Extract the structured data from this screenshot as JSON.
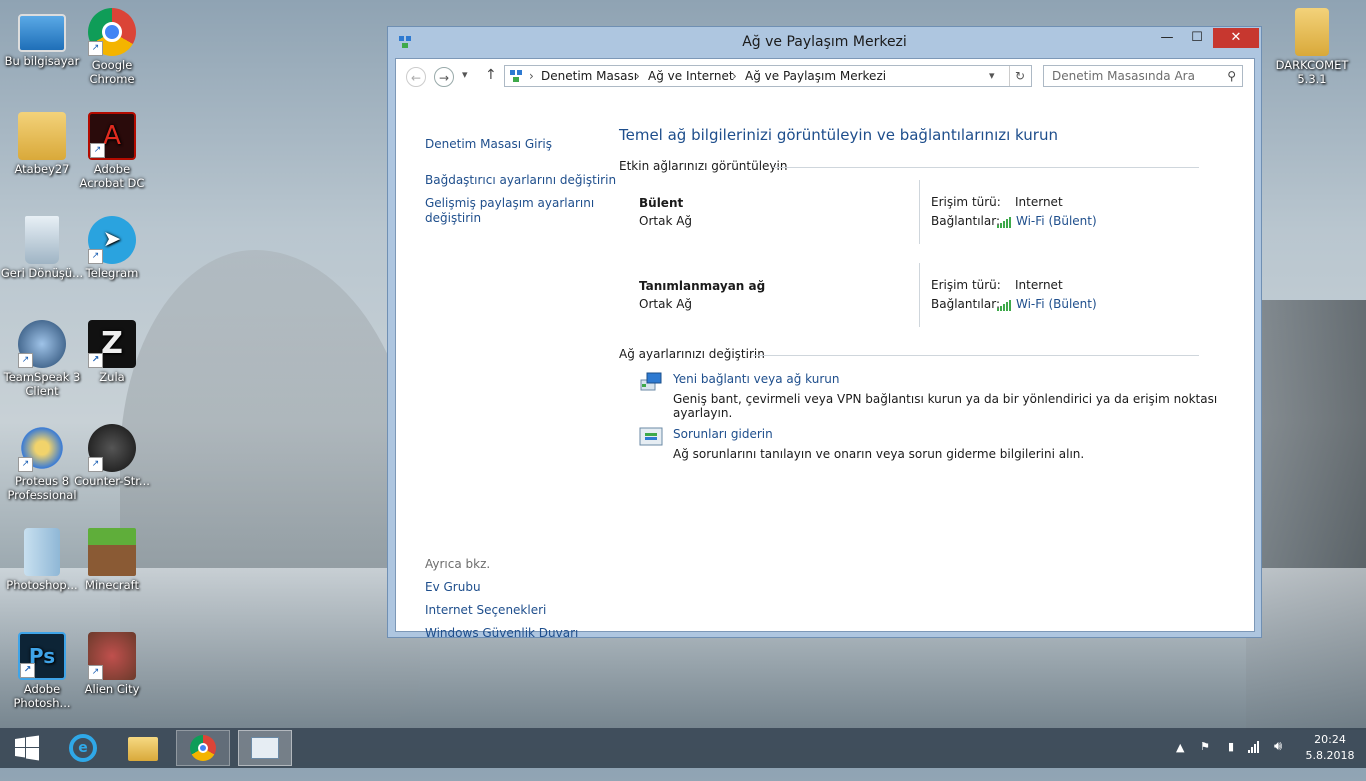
{
  "desktop": {
    "icons": [
      {
        "label": "Bu bilgisayar"
      },
      {
        "label": "Google Chrome"
      },
      {
        "label": "Atabey27"
      },
      {
        "label": "Adobe Acrobat DC"
      },
      {
        "label": "Geri Dönüşü..."
      },
      {
        "label": "Telegram"
      },
      {
        "label": "TeamSpeak 3 Client"
      },
      {
        "label": "Zula"
      },
      {
        "label": "Proteus 8 Professional"
      },
      {
        "label": "Counter-Str..."
      },
      {
        "label": "Photoshop..."
      },
      {
        "label": "Minecraft"
      },
      {
        "label": "Adobe Photosh..."
      },
      {
        "label": "Alien City"
      },
      {
        "label": "DARKCOMET 5.3.1"
      }
    ]
  },
  "window": {
    "title": "Ağ ve Paylaşım Merkezi",
    "controls": {
      "minimize": "—",
      "maximize": "☐",
      "close": "✕"
    },
    "nav": {
      "back": "←",
      "forward": "→",
      "dropdown": "▾",
      "up": "↑",
      "refresh": "↻"
    },
    "breadcrumb": [
      "Denetim Masası",
      "Ağ ve Internet",
      "Ağ ve Paylaşım Merkezi"
    ],
    "breadcrumb_sep": "›",
    "search_placeholder": "Denetim Masasında Ara",
    "sidebar": {
      "home": "Denetim Masası Giriş",
      "links": [
        "Bağdaştırıcı ayarlarını değiştirin",
        "Gelişmiş paylaşım ayarlarını değiştirin"
      ],
      "see_also_title": "Ayrıca bkz.",
      "see_also": [
        "Ev Grubu",
        "Internet Seçenekleri",
        "Windows Güvenlik Duvarı"
      ]
    },
    "main": {
      "title": "Temel ağ bilgilerinizi görüntüleyin ve bağlantılarınızı kurun",
      "active_networks_title": "Etkin ağlarınızı görüntüleyin",
      "access_label": "Erişim türü:",
      "connections_label": "Bağlantılar:",
      "networks": [
        {
          "name": "Bülent",
          "type": "Ortak Ağ",
          "access": "Internet",
          "connection": "Wi-Fi (Bülent)"
        },
        {
          "name": "Tanımlanmayan ağ",
          "type": "Ortak Ağ",
          "access": "Internet",
          "connection": "Wi-Fi (Bülent)"
        }
      ],
      "change_settings_title": "Ağ ayarlarınızı değiştirin",
      "tasks": [
        {
          "link": "Yeni bağlantı veya ağ kurun",
          "desc": "Geniş bant, çevirmeli veya VPN bağlantısı kurun ya da bir yönlendirici ya da erişim noktası ayarlayın."
        },
        {
          "link": "Sorunları giderin",
          "desc": "Ağ sorunlarını tanılayın ve onarın veya sorun giderme bilgilerini alın."
        }
      ]
    }
  },
  "taskbar": {
    "clock_time": "20:24",
    "clock_date": "5.8.2018"
  },
  "colors": {
    "link": "#1e4e8c",
    "close": "#c7372f",
    "signal": "#3ea94a"
  }
}
